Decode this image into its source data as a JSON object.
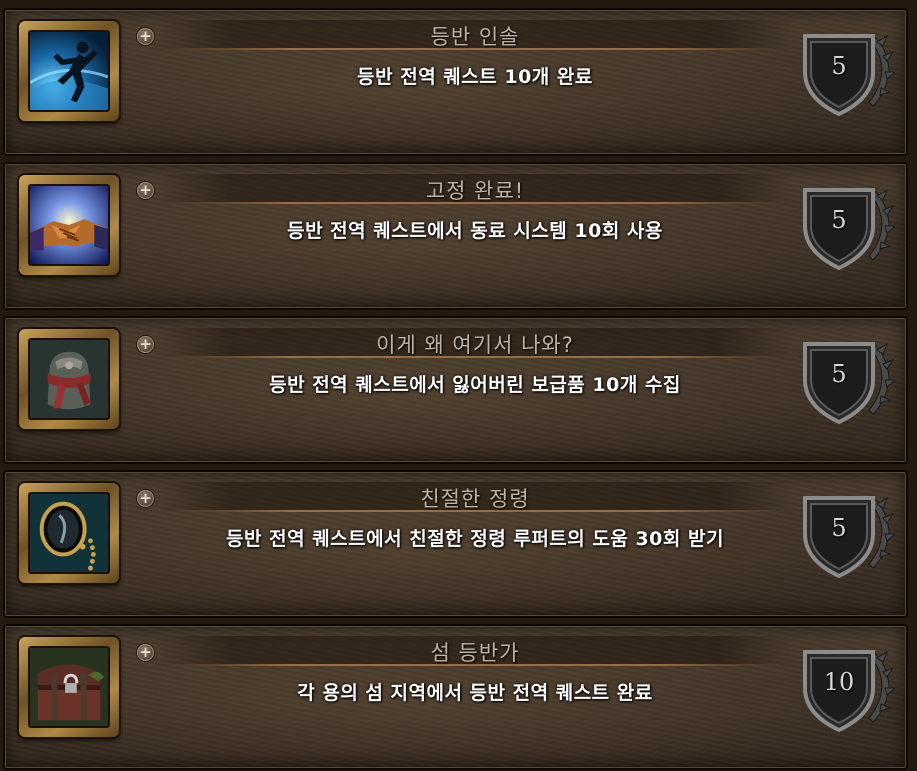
{
  "achievements": [
    {
      "icon": "running-figure-icon",
      "title": "등반 인솔",
      "description": "등반 전역 퀘스트 10개 완료",
      "points": "5"
    },
    {
      "icon": "handshake-icon",
      "title": "고정 완료!",
      "description": "등반 전역 퀘스트에서 동료 시스템 10회 사용",
      "points": "5"
    },
    {
      "icon": "supply-pack-icon",
      "title": "이게 왜 여기서 나와?",
      "description": "등반 전역 퀘스트에서 잃어버린 보급품 10개 수집",
      "points": "5"
    },
    {
      "icon": "monocle-icon",
      "title": "친절한 정령",
      "description": "등반 전역 퀘스트에서 친절한 정령 루퍼트의 도움 30회 받기",
      "points": "5"
    },
    {
      "icon": "treasure-chest-icon",
      "title": "섬 등반가",
      "description": "각 용의 섬 지역에서 등반 전역 퀘스트 완료",
      "points": "10"
    }
  ],
  "colors": {
    "title_text": "#bdb2a3",
    "description_text": "#ffffff",
    "frame_gold": "#c9a35a"
  }
}
